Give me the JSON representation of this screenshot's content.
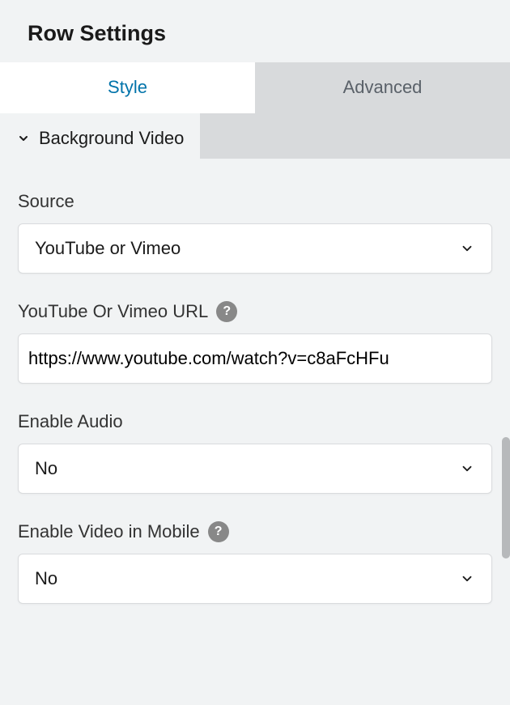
{
  "header": {
    "title": "Row Settings"
  },
  "tabs": {
    "style": "Style",
    "advanced": "Advanced"
  },
  "section": {
    "title": "Background Video"
  },
  "fields": {
    "source": {
      "label": "Source",
      "value": "YouTube or Vimeo"
    },
    "url": {
      "label": "YouTube Or Vimeo URL",
      "value": "https://www.youtube.com/watch?v=c8aFcHFu"
    },
    "enable_audio": {
      "label": "Enable Audio",
      "value": "No"
    },
    "enable_video_mobile": {
      "label": "Enable Video in Mobile",
      "value": "No"
    }
  }
}
